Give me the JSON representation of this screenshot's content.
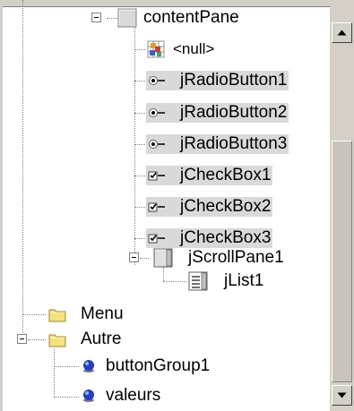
{
  "tree": {
    "nodes": [
      {
        "label": "contentPane",
        "icon": "panel-icon",
        "expanded": true
      },
      {
        "label": "<null>",
        "icon": "null-layout-icon"
      },
      {
        "label": "jRadioButton1",
        "icon": "radio-button-icon"
      },
      {
        "label": "jRadioButton2",
        "icon": "radio-button-icon"
      },
      {
        "label": "jRadioButton3",
        "icon": "radio-button-icon"
      },
      {
        "label": "jCheckBox1",
        "icon": "checkbox-icon"
      },
      {
        "label": "jCheckBox2",
        "icon": "checkbox-icon"
      },
      {
        "label": "jCheckBox3",
        "icon": "checkbox-icon"
      },
      {
        "label": "jScrollPane1",
        "icon": "scroll-pane-icon",
        "expanded": true
      },
      {
        "label": "jList1",
        "icon": "list-icon"
      },
      {
        "label": "Menu",
        "icon": "folder-icon"
      },
      {
        "label": "Autre",
        "icon": "folder-icon",
        "expanded": true
      },
      {
        "label": "buttonGroup1",
        "icon": "blue-bean-icon"
      },
      {
        "label": "valeurs",
        "icon": "blue-bean-icon"
      }
    ]
  },
  "scrollbar": {
    "up_icon": "arrow-up-icon",
    "down_icon": "arrow-down-icon"
  },
  "colors": {
    "selection": "#d9d9d9",
    "chrome": "#d4d0c8",
    "folder": "#f6e27a"
  }
}
